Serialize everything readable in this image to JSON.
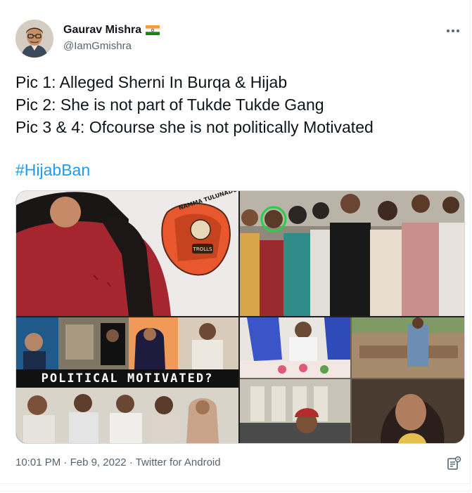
{
  "author": {
    "display_name": "Gaurav Mishra",
    "handle": "@IamGmishra",
    "flag_icon": "india-flag-icon"
  },
  "tweet": {
    "lines": [
      "Pic 1: Alleged Sherni In Burqa & Hijab",
      "Pic 2: She is not part of Tukde Tukde Gang",
      "Pic 3 & 4: Ofcourse she is not politically Motivated"
    ],
    "hashtag": "#HijabBan"
  },
  "media": {
    "caption": "POLITICAL MOTIVATED?",
    "logo_text": "NAMMA TULUNADU TROLLS"
  },
  "footer": {
    "time": "10:01 PM",
    "separator": "·",
    "date": "Feb 9, 2022",
    "source": "Twitter for Android"
  },
  "colors": {
    "link": "#1d9bf0",
    "secondary_text": "#536471",
    "primary_text": "#0f1419"
  }
}
